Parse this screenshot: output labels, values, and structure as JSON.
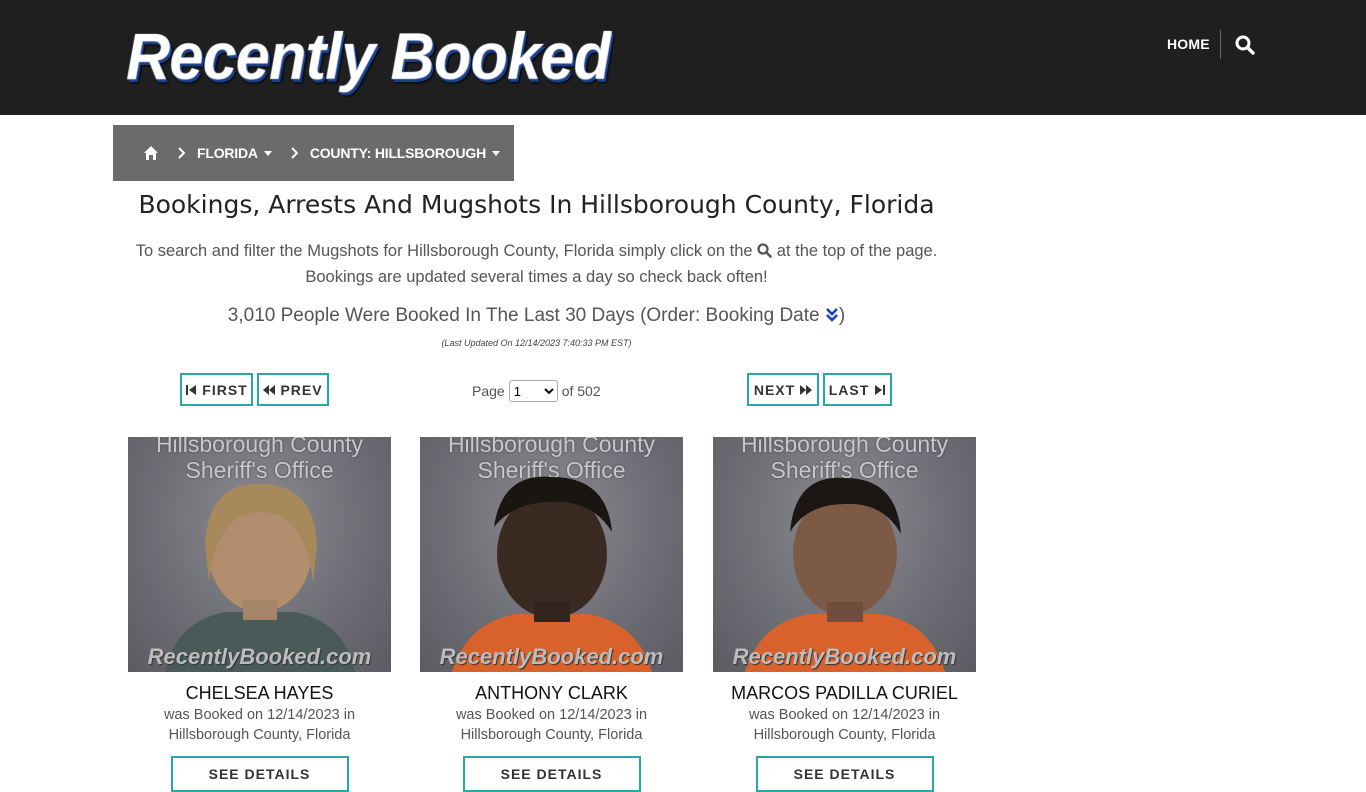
{
  "header": {
    "logo_text": "Recently Booked",
    "nav_home": "HOME",
    "search_icon": "search-icon"
  },
  "breadcrumb": {
    "home_icon": "home-icon",
    "state": "FLORIDA",
    "county": "COUNTY: HILLSBOROUGH"
  },
  "main": {
    "title": "Bookings, Arrests And Mugshots In Hillsborough County, Florida",
    "intro_before": "To search and filter the Mugshots for Hillsborough County, Florida simply click on the",
    "intro_after": "at the top of the page.",
    "intro_line2": "Bookings are updated several times a day so check back often!",
    "count_text": "3,010 People Were Booked In The Last 30 Days (Order: Booking Date",
    "count_close": ")",
    "last_updated": "(Last Updated On 12/14/2023 7:40:33 PM EST)"
  },
  "pagination": {
    "first": "FIRST",
    "prev": "PREV",
    "next": "NEXT",
    "last": "LAST",
    "page_label": "Page",
    "current_page": "1",
    "of_label": "of 502"
  },
  "cards": [
    {
      "photo_header_1": "Hillsborough County",
      "photo_header_2": "Sheriff's Office",
      "watermark": "RecentlyBooked.com",
      "name": "CHELSEA HAYES",
      "booked_line1": "was Booked on 12/14/2023 in",
      "booked_line2": "Hillsborough County, Florida",
      "details_label": "SEE DETAILS"
    },
    {
      "photo_header_1": "Hillsborough County",
      "photo_header_2": "Sheriff's Office",
      "watermark": "RecentlyBooked.com",
      "name": "ANTHONY CLARK",
      "booked_line1": "was Booked on 12/14/2023 in",
      "booked_line2": "Hillsborough County, Florida",
      "details_label": "SEE DETAILS"
    },
    {
      "photo_header_1": "Hillsborough County",
      "photo_header_2": "Sheriff's Office",
      "watermark": "RecentlyBooked.com",
      "name": "MARCOS PADILLA CURIEL",
      "booked_line1": "was Booked on 12/14/2023 in",
      "booked_line2": "Hillsborough County, Florida",
      "details_label": "SEE DETAILS"
    }
  ],
  "colors": {
    "topbar": "#1f1f1f",
    "breadcrumb": "#6b6b6b",
    "accent_teal": "#27a9a5",
    "order_icon": "#1a3fc4"
  }
}
